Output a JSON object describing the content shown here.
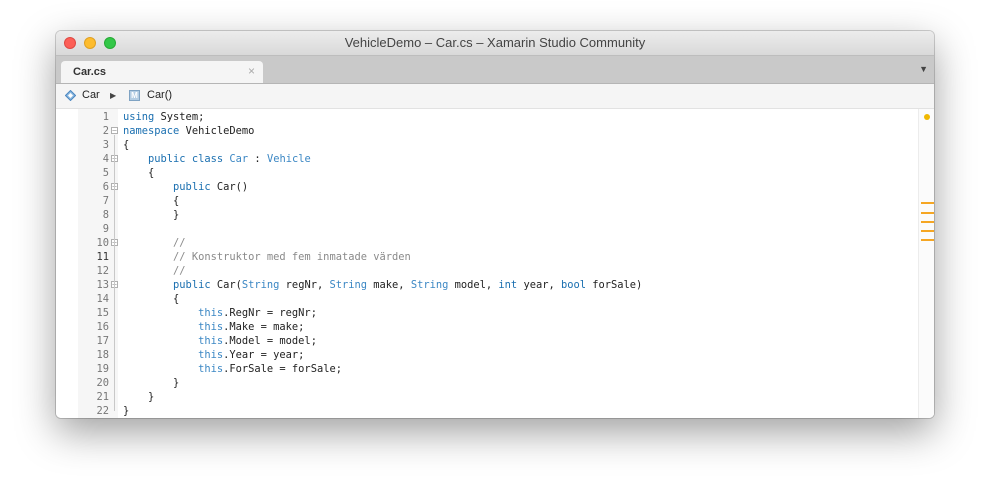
{
  "window": {
    "title": "VehicleDemo – Car.cs – Xamarin Studio Community"
  },
  "tabs": [
    {
      "label": "Car.cs",
      "close": "×"
    }
  ],
  "tab_overflow": "▼",
  "breadcrumb": {
    "class_name": "Car",
    "separator": "▶",
    "method_icon_text": "M",
    "method_name": "Car()"
  },
  "code": {
    "current_line": 11,
    "lines": [
      {
        "n": "1",
        "tokens": [
          {
            "t": "using",
            "c": "kw"
          },
          {
            "t": " System;",
            "c": ""
          }
        ]
      },
      {
        "n": "2",
        "fold": "⊟",
        "tokens": [
          {
            "t": "namespace",
            "c": "kw"
          },
          {
            "t": " VehicleDemo",
            "c": ""
          }
        ]
      },
      {
        "n": "3",
        "tokens": [
          {
            "t": "{",
            "c": ""
          }
        ]
      },
      {
        "n": "4",
        "fold": "⊟",
        "tokens": [
          {
            "t": "    ",
            "c": ""
          },
          {
            "t": "public class",
            "c": "kw"
          },
          {
            "t": " ",
            "c": ""
          },
          {
            "t": "Car",
            "c": "ty"
          },
          {
            "t": " : ",
            "c": ""
          },
          {
            "t": "Vehicle",
            "c": "ty"
          }
        ]
      },
      {
        "n": "5",
        "tokens": [
          {
            "t": "    {",
            "c": ""
          }
        ]
      },
      {
        "n": "6",
        "fold": "⊟",
        "tokens": [
          {
            "t": "        ",
            "c": ""
          },
          {
            "t": "public",
            "c": "kw"
          },
          {
            "t": " Car()",
            "c": ""
          }
        ]
      },
      {
        "n": "7",
        "tokens": [
          {
            "t": "        {",
            "c": ""
          }
        ]
      },
      {
        "n": "8",
        "tokens": [
          {
            "t": "        }",
            "c": ""
          }
        ]
      },
      {
        "n": "9",
        "tokens": []
      },
      {
        "n": "10",
        "fold": "⊟",
        "tokens": [
          {
            "t": "        ",
            "c": ""
          },
          {
            "t": "//",
            "c": "cm"
          }
        ]
      },
      {
        "n": "11",
        "tokens": [
          {
            "t": "        ",
            "c": ""
          },
          {
            "t": "// Konstruktor med fem inmatade värden",
            "c": "cm"
          }
        ]
      },
      {
        "n": "12",
        "tokens": [
          {
            "t": "        ",
            "c": ""
          },
          {
            "t": "//",
            "c": "cm"
          }
        ]
      },
      {
        "n": "13",
        "fold": "⊟",
        "tokens": [
          {
            "t": "        ",
            "c": ""
          },
          {
            "t": "public",
            "c": "kw"
          },
          {
            "t": " Car(",
            "c": ""
          },
          {
            "t": "String",
            "c": "ty"
          },
          {
            "t": " regNr, ",
            "c": ""
          },
          {
            "t": "String",
            "c": "ty"
          },
          {
            "t": " make, ",
            "c": ""
          },
          {
            "t": "String",
            "c": "ty"
          },
          {
            "t": " model, ",
            "c": ""
          },
          {
            "t": "int",
            "c": "kw"
          },
          {
            "t": " year, ",
            "c": ""
          },
          {
            "t": "bool",
            "c": "kw"
          },
          {
            "t": " forSale)",
            "c": ""
          }
        ]
      },
      {
        "n": "14",
        "tokens": [
          {
            "t": "        {",
            "c": ""
          }
        ]
      },
      {
        "n": "15",
        "tokens": [
          {
            "t": "            ",
            "c": ""
          },
          {
            "t": "this",
            "c": "ty"
          },
          {
            "t": ".RegNr = regNr;",
            "c": ""
          }
        ]
      },
      {
        "n": "16",
        "tokens": [
          {
            "t": "            ",
            "c": ""
          },
          {
            "t": "this",
            "c": "ty"
          },
          {
            "t": ".Make = make;",
            "c": ""
          }
        ]
      },
      {
        "n": "17",
        "tokens": [
          {
            "t": "            ",
            "c": ""
          },
          {
            "t": "this",
            "c": "ty"
          },
          {
            "t": ".Model = model;",
            "c": ""
          }
        ]
      },
      {
        "n": "18",
        "tokens": [
          {
            "t": "            ",
            "c": ""
          },
          {
            "t": "this",
            "c": "ty"
          },
          {
            "t": ".Year = year;",
            "c": ""
          }
        ]
      },
      {
        "n": "19",
        "tokens": [
          {
            "t": "            ",
            "c": ""
          },
          {
            "t": "this",
            "c": "ty"
          },
          {
            "t": ".ForSale = forSale;",
            "c": ""
          }
        ]
      },
      {
        "n": "20",
        "tokens": [
          {
            "t": "        }",
            "c": ""
          }
        ]
      },
      {
        "n": "21",
        "tokens": [
          {
            "t": "    }",
            "c": ""
          }
        ]
      },
      {
        "n": "22",
        "tokens": [
          {
            "t": "}",
            "c": ""
          }
        ]
      }
    ]
  },
  "overview_ruler": {
    "warning_color": "#f0b800",
    "mark_color": "#f5a623"
  }
}
